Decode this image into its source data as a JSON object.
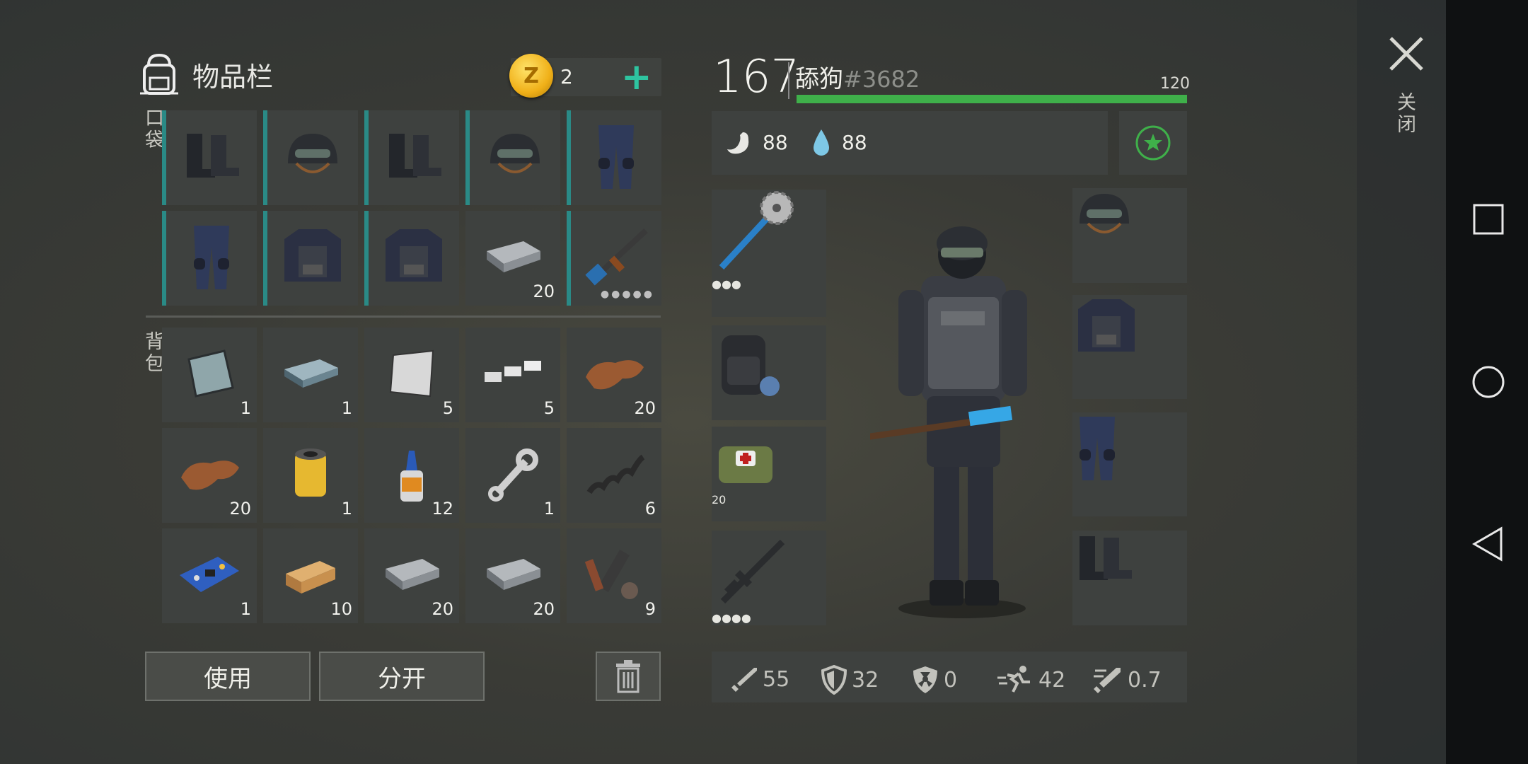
{
  "inventory": {
    "title": "物品栏",
    "coins": "2",
    "pocket_label": "口袋",
    "backpack_label": "背包",
    "pocket_items": [
      {
        "name": "boots",
        "count": "",
        "bar": true
      },
      {
        "name": "helmet",
        "count": "",
        "bar": true
      },
      {
        "name": "boots",
        "count": "",
        "bar": true
      },
      {
        "name": "helmet",
        "count": "",
        "bar": true
      },
      {
        "name": "pants",
        "count": "",
        "bar": true
      },
      {
        "name": "pants",
        "count": "",
        "bar": true
      },
      {
        "name": "vest",
        "count": "",
        "bar": true
      },
      {
        "name": "vest",
        "count": "",
        "bar": true
      },
      {
        "name": "iron-bar",
        "count": "20",
        "bar": false
      },
      {
        "name": "rifle",
        "count": "",
        "bar": true,
        "dots": "●●●●●"
      }
    ],
    "backpack_items": [
      {
        "name": "glass",
        "count": "1"
      },
      {
        "name": "steel-ingot",
        "count": "1"
      },
      {
        "name": "metal-sheet",
        "count": "5"
      },
      {
        "name": "silver-bars",
        "count": "5"
      },
      {
        "name": "leather",
        "count": "20"
      },
      {
        "name": "leather",
        "count": "20"
      },
      {
        "name": "filter",
        "count": "1"
      },
      {
        "name": "glue",
        "count": "12"
      },
      {
        "name": "wrench",
        "count": "1"
      },
      {
        "name": "spring",
        "count": "6"
      },
      {
        "name": "circuit-board",
        "count": "1"
      },
      {
        "name": "wood-plank",
        "count": "10"
      },
      {
        "name": "iron-bar",
        "count": "20"
      },
      {
        "name": "iron-bar",
        "count": "20"
      },
      {
        "name": "weapon-parts",
        "count": "9"
      }
    ],
    "use_label": "使用",
    "split_label": "分开"
  },
  "player": {
    "level": "167",
    "name": "舔狗",
    "id": "#3682",
    "xp_value": "120",
    "hunger": "88",
    "thirst": "88"
  },
  "equipment_left": [
    {
      "name": "saw-mace",
      "count": "",
      "dots": "●●●"
    },
    {
      "name": "backpack",
      "count": ""
    },
    {
      "name": "medkit-bag",
      "count": "20"
    },
    {
      "name": "assault-rifle",
      "count": "",
      "dots": "●●●●"
    }
  ],
  "equipment_right": [
    "helmet",
    "vest",
    "pants",
    "boots"
  ],
  "bottom_stats": {
    "attack": "55",
    "defense": "32",
    "radiation": "0",
    "speed": "42",
    "attack_speed": "0.7"
  },
  "close_label": "关闭",
  "colors": {
    "accent": "#2ec4a0",
    "xp": "#3fb04a",
    "slot": "#3e413f",
    "rarity": "#2a8a86"
  }
}
